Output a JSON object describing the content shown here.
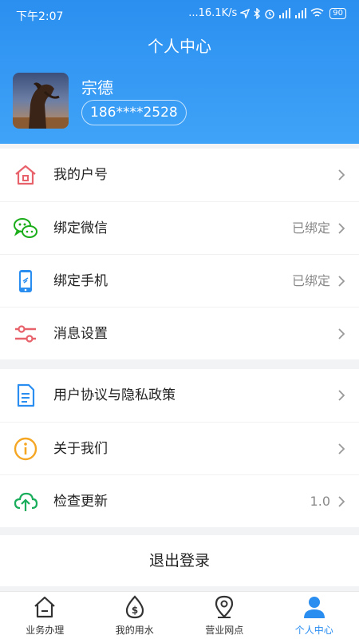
{
  "status_bar": {
    "time": "下午2:07",
    "net_speed": "...16.1K/s",
    "battery": "90"
  },
  "header": {
    "title": "个人中心"
  },
  "profile": {
    "name": "宗德",
    "phone": "186****2528"
  },
  "menu_group_1": [
    {
      "label": "我的户号",
      "value": "",
      "icon": "house-icon"
    },
    {
      "label": "绑定微信",
      "value": "已绑定",
      "icon": "wechat-icon"
    },
    {
      "label": "绑定手机",
      "value": "已绑定",
      "icon": "mobile-phone-icon"
    },
    {
      "label": "消息设置",
      "value": "",
      "icon": "sliders-icon"
    }
  ],
  "menu_group_2": [
    {
      "label": "用户协议与隐私政策",
      "value": "",
      "icon": "document-icon"
    },
    {
      "label": "关于我们",
      "value": "",
      "icon": "info-icon"
    },
    {
      "label": "检查更新",
      "value": "1.0",
      "icon": "cloud-upload-icon"
    }
  ],
  "logout_label": "退出登录",
  "tabs": [
    {
      "label": "业务办理",
      "icon": "home-icon"
    },
    {
      "label": "我的用水",
      "icon": "water-drop-icon"
    },
    {
      "label": "营业网点",
      "icon": "location-pin-icon"
    },
    {
      "label": "个人中心",
      "icon": "person-icon"
    }
  ],
  "colors": {
    "primary": "#2a8df0",
    "house": "#e8626b",
    "wechat": "#1aad19",
    "phone": "#2a8df0",
    "sliders": "#e8626b",
    "doc": "#2a8df0",
    "info": "#f5a623",
    "cloud": "#1aad5c"
  }
}
